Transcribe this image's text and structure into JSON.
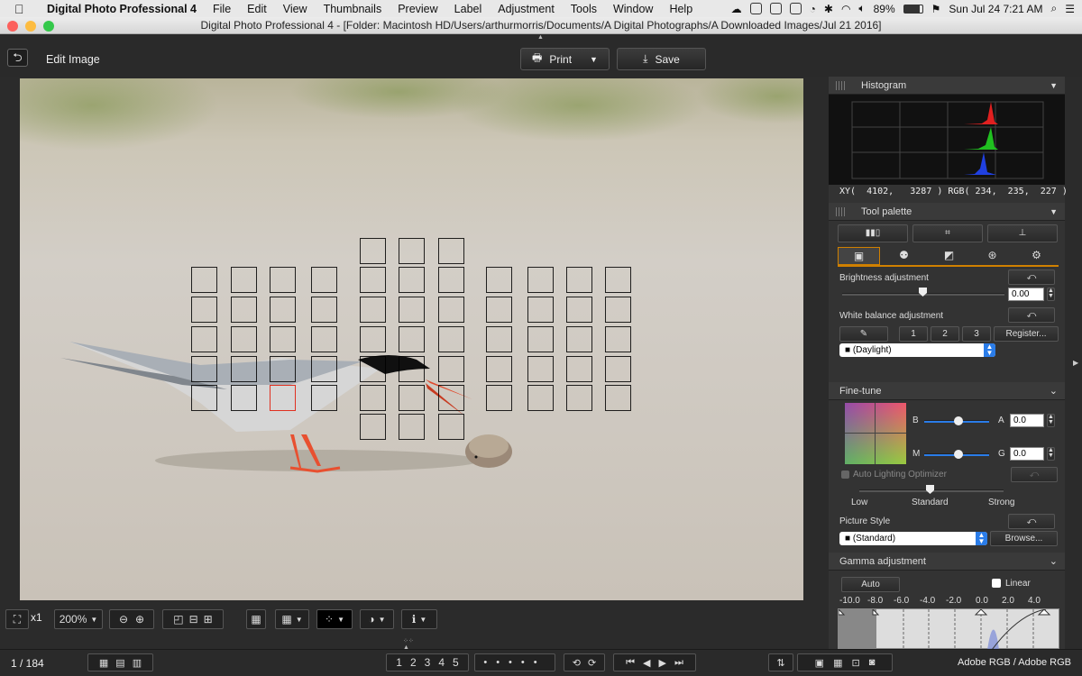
{
  "menubar": {
    "app_name": "Digital Photo Professional 4",
    "items": [
      "File",
      "Edit",
      "View",
      "Thumbnails",
      "Preview",
      "Label",
      "Adjustment",
      "Tools",
      "Window",
      "Help"
    ],
    "battery": "89%",
    "clock": "Sun Jul 24  7:21 AM"
  },
  "window": {
    "title": "Digital Photo Professional 4 - [Folder: Macintosh HD/Users/arthurmorris/Documents/A Digital Photographs/A Downloaded Images/Jul 21 2016]"
  },
  "toolbar": {
    "mode_label": "Edit Image",
    "print_label": "Print",
    "save_label": "Save"
  },
  "histogram": {
    "title": "Histogram",
    "readout": "XY(  4102,   3287 ) RGB( 234,  235,  227 )"
  },
  "tool_palette": {
    "title": "Tool palette",
    "brightness_label": "Brightness adjustment",
    "brightness_value": "0.00",
    "wb_label": "White balance adjustment",
    "wb_buttons": [
      "1",
      "2",
      "3"
    ],
    "register_label": "Register...",
    "wb_preset": "(Daylight)"
  },
  "finetune": {
    "title": "Fine-tune",
    "b_label": "B",
    "a_label": "A",
    "a_value": "0.0",
    "m_label": "M",
    "g_label": "G",
    "g_value": "0.0",
    "alo_label": "Auto Lighting Optimizer",
    "alo_low": "Low",
    "alo_standard": "Standard",
    "alo_strong": "Strong",
    "picture_style_label": "Picture Style",
    "picture_style_value": "(Standard)",
    "browse_label": "Browse..."
  },
  "gamma": {
    "title": "Gamma adjustment",
    "auto_label": "Auto",
    "linear_label": "Linear",
    "scale": [
      "-10.0",
      "-8.0",
      "-6.0",
      "-4.0",
      "-2.0",
      "0.0",
      "2.0",
      "4.0"
    ]
  },
  "viewbar": {
    "zoom_x1": "x1",
    "zoom_level": "200%"
  },
  "statusbar": {
    "page_count": "1 / 184",
    "ratings": [
      "1",
      "2",
      "3",
      "4",
      "5"
    ],
    "color_space": "Adobe RGB / Adobe RGB"
  }
}
